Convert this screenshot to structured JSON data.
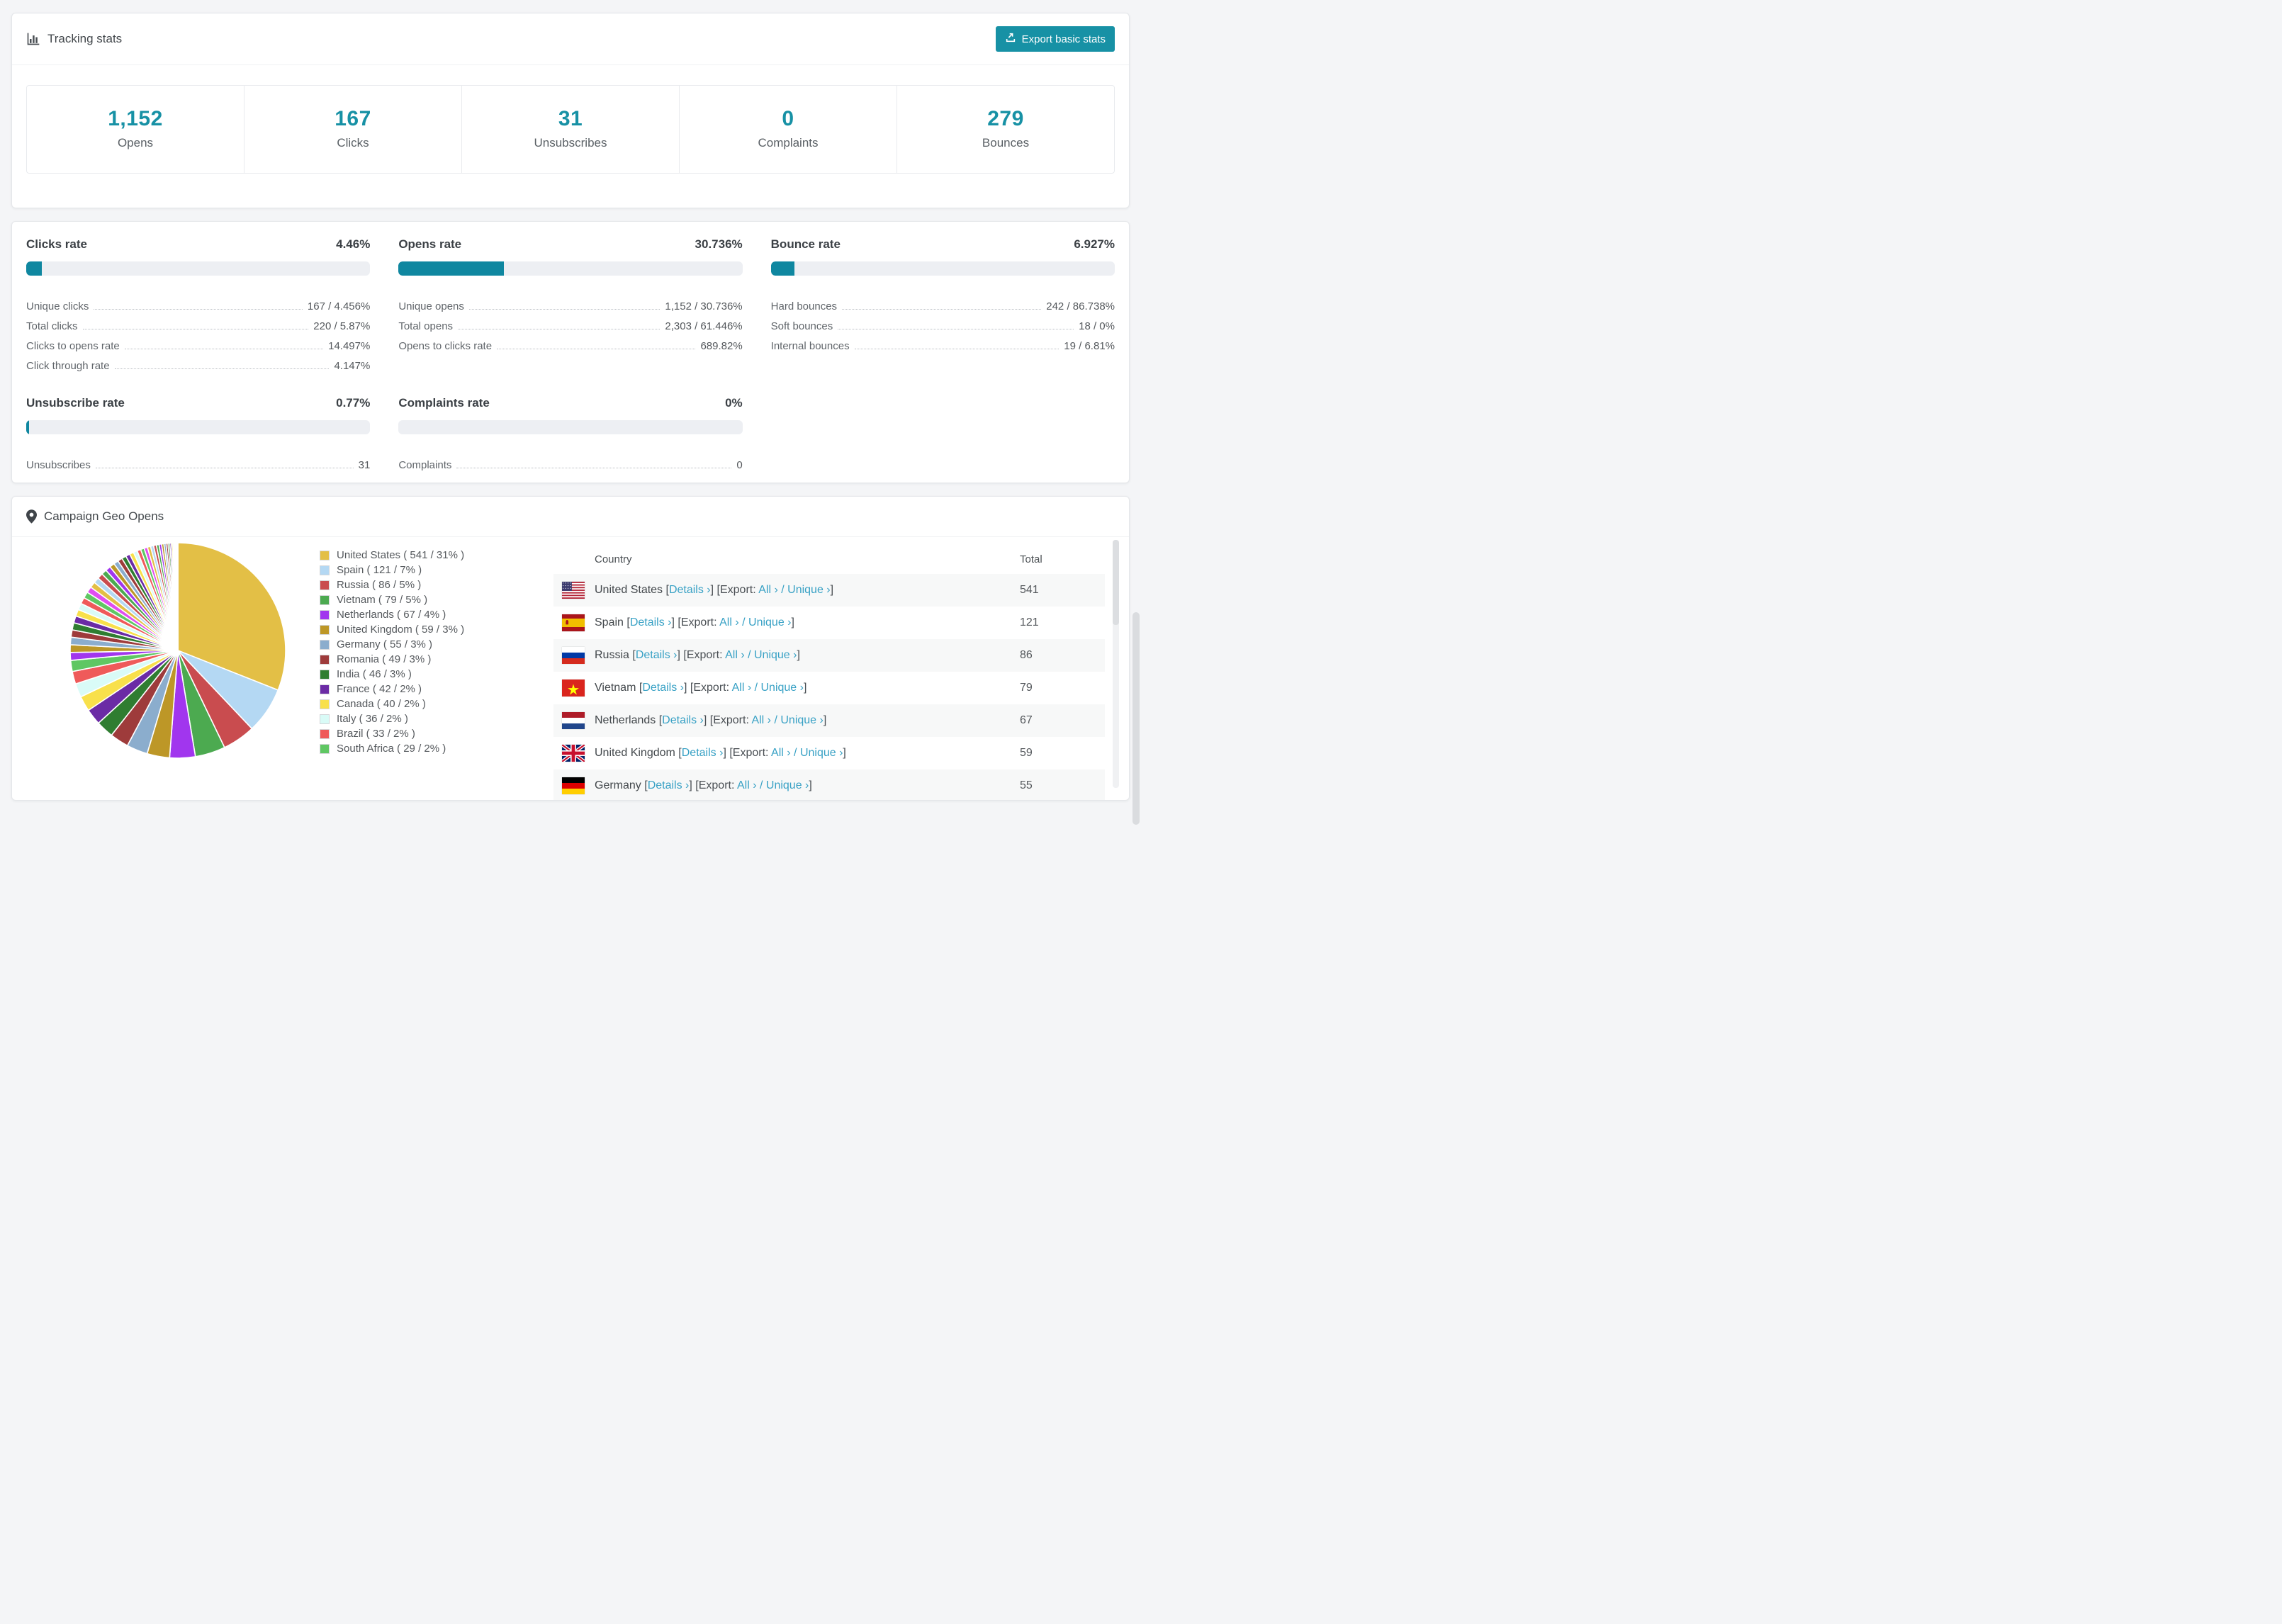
{
  "colors": {
    "accent_teal": "#1791a5",
    "bar_fill": "#0f87a0",
    "bar_track": "#edeff3",
    "link_blue": "#38a1c5",
    "page_bg": "#f4f5f7"
  },
  "tracking": {
    "title": "Tracking stats",
    "export_button_label": "Export basic stats",
    "summary": [
      {
        "value": "1,152",
        "label": "Opens"
      },
      {
        "value": "167",
        "label": "Clicks"
      },
      {
        "value": "31",
        "label": "Unsubscribes"
      },
      {
        "value": "0",
        "label": "Complaints"
      },
      {
        "value": "279",
        "label": "Bounces"
      }
    ]
  },
  "rates": {
    "sections": [
      {
        "title": "Clicks rate",
        "value": "4.46%",
        "bar_pct": 4.46,
        "rows": [
          {
            "label": "Unique clicks",
            "value": "167 / 4.456%"
          },
          {
            "label": "Total clicks",
            "value": "220 / 5.87%"
          },
          {
            "label": "Clicks to opens rate",
            "value": "14.497%"
          },
          {
            "label": "Click through rate",
            "value": "4.147%"
          }
        ]
      },
      {
        "title": "Opens rate",
        "value": "30.736%",
        "bar_pct": 30.736,
        "rows": [
          {
            "label": "Unique opens",
            "value": "1,152 / 30.736%"
          },
          {
            "label": "Total opens",
            "value": "2,303 / 61.446%"
          },
          {
            "label": "Opens to clicks rate",
            "value": "689.82%"
          }
        ]
      },
      {
        "title": "Bounce rate",
        "value": "6.927%",
        "bar_pct": 6.927,
        "rows": [
          {
            "label": "Hard bounces",
            "value": "242 / 86.738%"
          },
          {
            "label": "Soft bounces",
            "value": "18 / 0%"
          },
          {
            "label": "Internal bounces",
            "value": "19 / 6.81%"
          }
        ]
      },
      {
        "title": "Unsubscribe rate",
        "value": "0.77%",
        "bar_pct": 0.77,
        "rows": [
          {
            "label": "Unsubscribes",
            "value": "31"
          }
        ]
      },
      {
        "title": "Complaints rate",
        "value": "0%",
        "bar_pct": 0,
        "rows": [
          {
            "label": "Complaints",
            "value": "0"
          }
        ]
      }
    ]
  },
  "geo": {
    "title": "Campaign Geo Opens",
    "table": {
      "col_country": "Country",
      "col_total": "Total",
      "bracket_open": "[",
      "bracket_close": "]",
      "details_label": "Details ›",
      "export_prefix": "Export:",
      "all_label": "All ›",
      "slash": "/",
      "unique_label": "Unique ›",
      "rows": [
        {
          "country": "United States",
          "flag": "us",
          "total": "541"
        },
        {
          "country": "Spain",
          "flag": "es",
          "total": "121"
        },
        {
          "country": "Russia",
          "flag": "ru",
          "total": "86"
        },
        {
          "country": "Vietnam",
          "flag": "vn",
          "total": "79"
        },
        {
          "country": "Netherlands",
          "flag": "nl",
          "total": "67"
        },
        {
          "country": "United Kingdom",
          "flag": "gb",
          "total": "59"
        },
        {
          "country": "Germany",
          "flag": "de",
          "total": "55"
        }
      ]
    }
  },
  "chart_data": {
    "type": "pie",
    "title": "Campaign Geo Opens",
    "legend_position": "right",
    "start_angle_deg": 0,
    "direction": "clockwise",
    "slices": [
      {
        "label": "United States",
        "value": 541,
        "pct": 31,
        "color": "#e3bf46"
      },
      {
        "label": "Spain",
        "value": 121,
        "pct": 7,
        "color": "#b4d8f3"
      },
      {
        "label": "Russia",
        "value": 86,
        "pct": 5,
        "color": "#c94c4f"
      },
      {
        "label": "Vietnam",
        "value": 79,
        "pct": 5,
        "color": "#4caa50"
      },
      {
        "label": "Netherlands",
        "value": 67,
        "pct": 4,
        "color": "#a136ee"
      },
      {
        "label": "United Kingdom",
        "value": 59,
        "pct": 3,
        "color": "#bd9727"
      },
      {
        "label": "Germany",
        "value": 55,
        "pct": 3,
        "color": "#8badcd"
      },
      {
        "label": "Romania",
        "value": 49,
        "pct": 3,
        "color": "#9e3b3b"
      },
      {
        "label": "India",
        "value": 46,
        "pct": 3,
        "color": "#2f7d31"
      },
      {
        "label": "France",
        "value": 42,
        "pct": 2,
        "color": "#6b2ba5"
      },
      {
        "label": "Canada",
        "value": 40,
        "pct": 2,
        "color": "#f8e04b"
      },
      {
        "label": "Italy",
        "value": 36,
        "pct": 2,
        "color": "#d9fbf7"
      },
      {
        "label": "Brazil",
        "value": 33,
        "pct": 2,
        "color": "#ef5a5a"
      },
      {
        "label": "South Africa",
        "value": 29,
        "pct": 2,
        "color": "#5fc763"
      }
    ],
    "others_unlabeled": {
      "estimated_total": 462,
      "estimated_slice_count": 44
    },
    "others_palette": [
      "#a136ee",
      "#bd9727",
      "#8badcd",
      "#9e3b3b",
      "#2f7d31",
      "#6b2ba5",
      "#f8e04b",
      "#d9fbf7",
      "#ef5a5a",
      "#5fc763",
      "#e04df0",
      "#e3bf46",
      "#b4d8f3",
      "#c94c4f",
      "#4caa50"
    ],
    "legend_format": "{label} ( {value} / {pct}% )"
  }
}
